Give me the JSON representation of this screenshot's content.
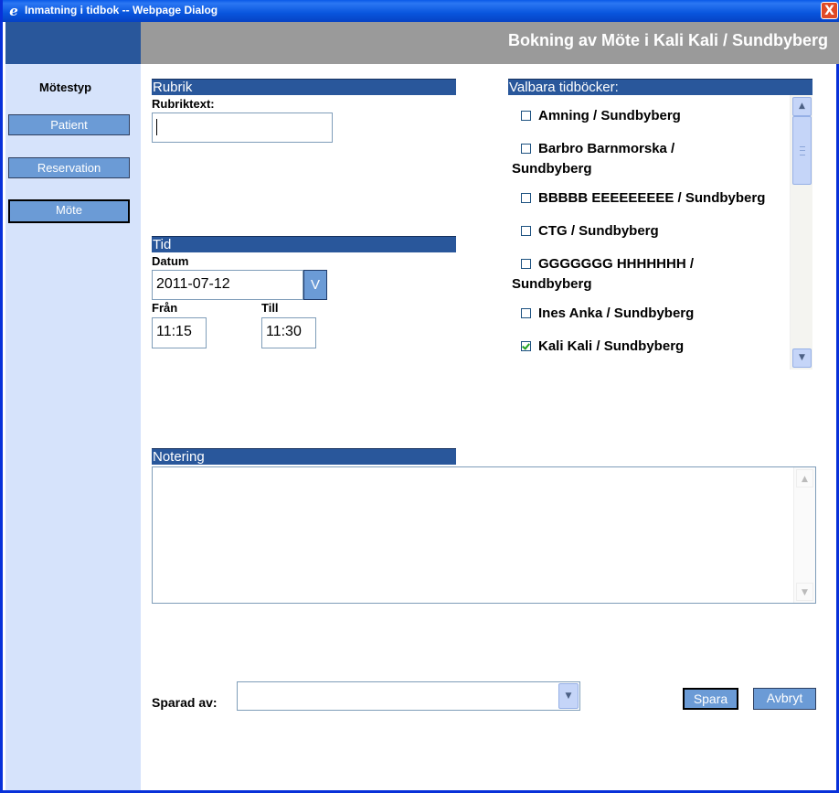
{
  "window": {
    "title": "Inmatning i tidbok -- Webpage Dialog",
    "close_label": "X"
  },
  "header": {
    "title": "Bokning av Möte  i Kali Kali / Sundbyberg"
  },
  "sidebar": {
    "title": "Mötestyp",
    "buttons": [
      {
        "label": "Patient"
      },
      {
        "label": "Reservation"
      },
      {
        "label": "Möte",
        "active": true
      }
    ]
  },
  "rubrik": {
    "header": "Rubrik",
    "label": "Rubriktext:",
    "value": ""
  },
  "tid": {
    "header": "Tid",
    "datum_label": "Datum",
    "datum_value": "2011-07-12",
    "datum_button": "V",
    "fran_label": "Från",
    "fran_value": "11:15",
    "till_label": "Till",
    "till_value": "11:30"
  },
  "tidbocker": {
    "header": "Valbara tidböcker:",
    "items": [
      {
        "line1": "Amning / Sundbyberg",
        "line2": "",
        "checked": false
      },
      {
        "line1": "Barbro Barnmorska /",
        "line2": "Sundbyberg",
        "checked": false
      },
      {
        "line1": "BBBBB EEEEEEEEE / Sundbyberg",
        "line2": "",
        "checked": false
      },
      {
        "line1": "CTG / Sundbyberg",
        "line2": "",
        "checked": false
      },
      {
        "line1": "GGGGGGG HHHHHHH /",
        "line2": "Sundbyberg",
        "checked": false
      },
      {
        "line1": "Ines Anka / Sundbyberg",
        "line2": "",
        "checked": false
      },
      {
        "line1": "Kali Kali / Sundbyberg",
        "line2": "",
        "checked": true
      }
    ]
  },
  "notering": {
    "header": "Notering",
    "value": ""
  },
  "footer": {
    "sparad_label": "Sparad av:",
    "sparad_value": "",
    "save_label": "Spara",
    "cancel_label": "Avbryt"
  }
}
